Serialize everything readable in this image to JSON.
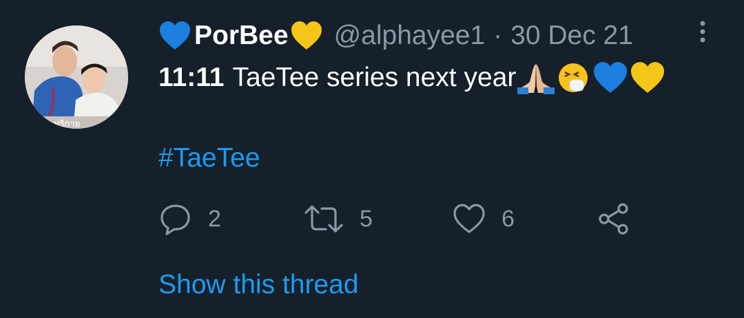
{
  "tweet": {
    "author": {
      "display_name": "PorBee",
      "name_emoji_left": "blue-heart",
      "name_emoji_right": "yellow-heart",
      "handle": "@alphayee1",
      "separator": "·",
      "date": "30 Dec 21"
    },
    "body": {
      "bold_text": "11:11",
      "text": "TaeTee series next year",
      "emojis": [
        "folded-hands",
        "sneezing-face",
        "blue-heart",
        "yellow-heart"
      ]
    },
    "hashtag": "#TaeTee",
    "actions": {
      "reply_count": "2",
      "retweet_count": "5",
      "like_count": "6"
    },
    "show_thread": "Show this thread"
  },
  "colors": {
    "background": "#15202b",
    "text_primary": "#ffffff",
    "text_secondary": "#8b98a5",
    "link": "#1d9bf0"
  },
  "icons": {
    "reply": "reply-icon",
    "retweet": "retweet-icon",
    "like": "like-icon",
    "share": "share-icon",
    "more": "more-vertical-icon"
  }
}
